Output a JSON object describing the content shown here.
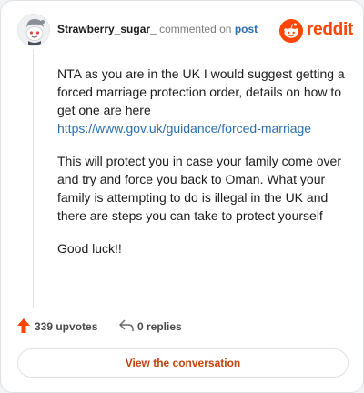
{
  "header": {
    "username": "Strawberry_sugar_",
    "action_text": "commented on",
    "post_link": "post",
    "brand_word": "reddit",
    "avatar_icon": "snoo-avatar-icon"
  },
  "comment": {
    "paragraph1_text": "NTA as you are in the UK I would suggest getting a forced marriage protection order, details on how to get one are here",
    "paragraph1_link": "https://www.gov.uk/guidance/forced-marriage",
    "paragraph2": "This will protect you in case your family come over and try and force you back to Oman. What your family is attempting to do is illegal in the UK and there are steps you can take to protect yourself",
    "paragraph3": "Good luck!!"
  },
  "footer": {
    "upvotes": "339 upvotes",
    "replies": "0 replies",
    "upvote_icon": "upvote-arrow-icon",
    "reply_icon": "reply-arrow-icon",
    "button_label": "View the conversation"
  },
  "colors": {
    "brand": "#ff4500",
    "link": "#2a6fb0",
    "button_text": "#c2410c"
  }
}
